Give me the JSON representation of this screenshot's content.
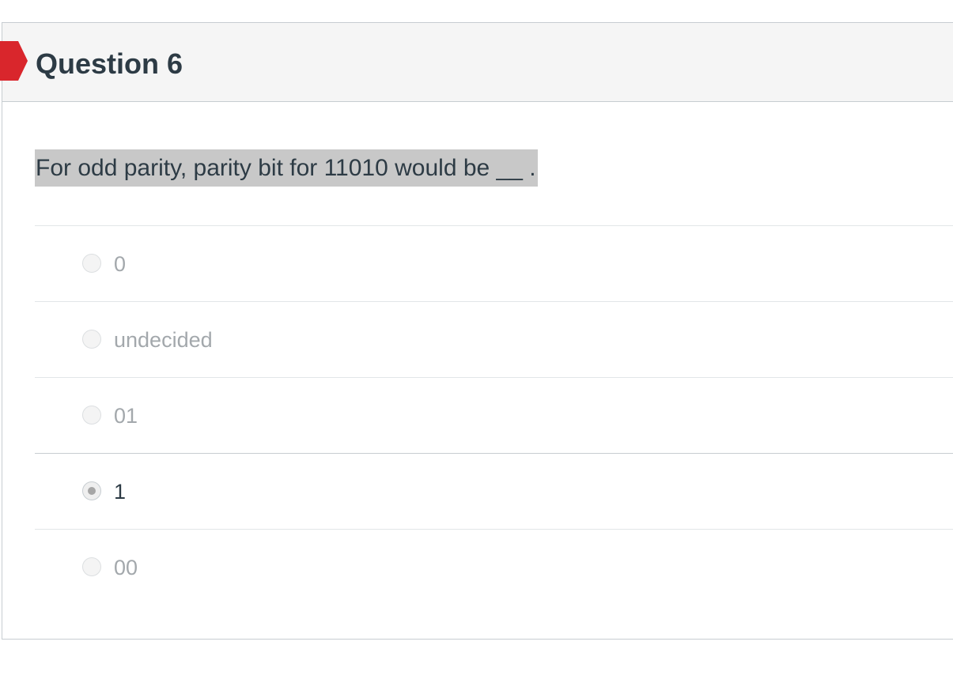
{
  "question": {
    "title": "Question 6",
    "text": "For odd parity, parity bit for 11010 would be __ .",
    "flag_color": "#d9262c"
  },
  "answers": [
    {
      "label": "0",
      "selected": false
    },
    {
      "label": "undecided",
      "selected": false
    },
    {
      "label": "01",
      "selected": false
    },
    {
      "label": "1",
      "selected": true
    },
    {
      "label": "00",
      "selected": false
    }
  ]
}
